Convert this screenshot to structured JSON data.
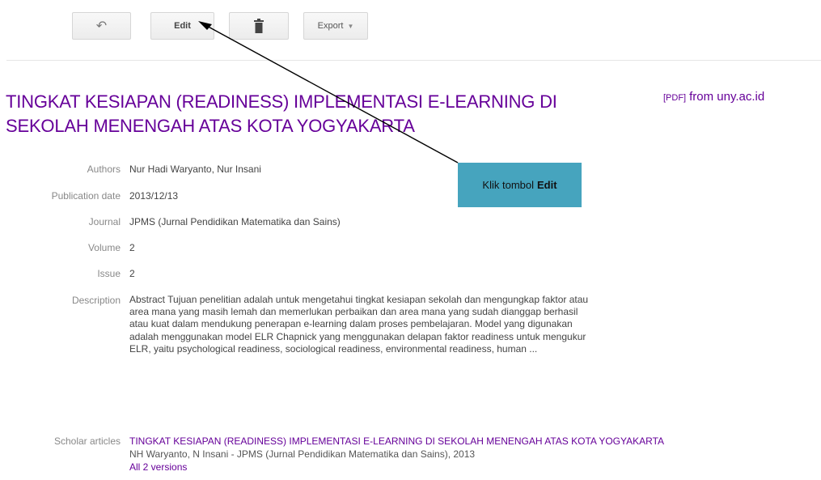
{
  "toolbar": {
    "back_label": "↶",
    "edit_label": "Edit",
    "delete_label": "🗑",
    "export_label": "Export",
    "export_caret": "▼"
  },
  "article": {
    "title": "TINGKAT KESIAPAN (READINESS) IMPLEMENTASI E-LEARNING DI SEKOLAH MENENGAH ATAS KOTA YOGYAKARTA",
    "pdf_tag": "[PDF]",
    "pdf_source": "from uny.ac.id"
  },
  "fields": [
    {
      "label": "Authors",
      "value": "Nur Hadi Waryanto, Nur Insani"
    },
    {
      "label": "Publication date",
      "value": "2013/12/13"
    },
    {
      "label": "Journal",
      "value": "JPMS (Jurnal Pendidikan Matematika dan Sains)"
    },
    {
      "label": "Volume",
      "value": "2"
    },
    {
      "label": "Issue",
      "value": "2"
    },
    {
      "label": "Description",
      "value": "Abstract Tujuan penelitian adalah untuk mengetahui tingkat kesiapan sekolah dan mengungkap faktor atau area mana yang masih lemah dan memerlukan perbaikan dan area mana yang sudah dianggap berhasil atau kuat dalam mendukung penerapan e-learning dalam proses pembelajaran. Model yang digunakan adalah menggunakan model ELR Chapnick yang menggunakan delapan faktor readiness untuk mengukur ELR, yaitu psychological readiness, sociological readiness, environmental readiness, human ..."
    }
  ],
  "scholar": {
    "label": "Scholar articles",
    "title": "TINGKAT KESIAPAN (READINESS) IMPLEMENTASI E-LEARNING DI SEKOLAH MENENGAH ATAS KOTA YOGYAKARTA",
    "meta": "NH Waryanto, N Insani - JPMS (Jurnal Pendidikan Matematika dan Sains), 2013",
    "versions": "All 2 versions"
  },
  "callout": {
    "text": "Klik tombol",
    "bold": "Edit",
    "color": "#46a4be"
  },
  "colors": {
    "title": "#660099",
    "label": "#888888"
  }
}
